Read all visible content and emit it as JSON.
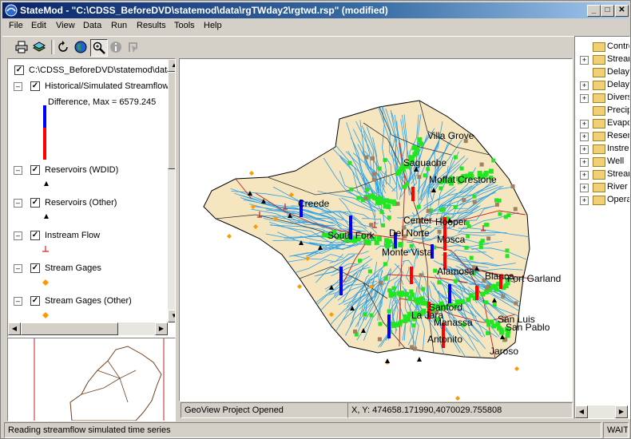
{
  "window": {
    "title": "StateMod - \"C:\\CDSS_BeforeDVD\\statemod\\data\\rgTWday2\\rgtwd.rsp\" (modified)",
    "minimize_glyph": "_",
    "maximize_glyph": "□",
    "close_glyph": "✕"
  },
  "menu": [
    "File",
    "Edit",
    "View",
    "Data",
    "Run",
    "Results",
    "Tools",
    "Help"
  ],
  "toolbar_icons": [
    "print-icon",
    "layers-icon",
    "refresh-icon",
    "globe-icon",
    "zoom-icon",
    "info-icon",
    "select-icon"
  ],
  "legend": {
    "project_path": "C:\\CDSS_BeforeDVD\\statemod\\data",
    "layers": [
      {
        "label": "Historical/Simulated Streamflow",
        "sub": "Difference, Max = 6579.245"
      },
      {
        "label": "Reservoirs (WDID)"
      },
      {
        "label": "Reservoirs (Other)"
      },
      {
        "label": "Instream Flow"
      },
      {
        "label": "Stream Gages"
      },
      {
        "label": "Stream Gages (Other)"
      }
    ],
    "expander": "–",
    "check": "✓"
  },
  "map": {
    "colors": {
      "basin": "#f5e6c0",
      "stream": "#2aa0e8",
      "road": "#c02020",
      "positive": "#0000ff",
      "negative": "#ff0000",
      "node": "#22e622",
      "diversion": "#a08060",
      "gage": "#ff9900"
    },
    "labels": [
      "Villa Grove",
      "Saguache",
      "Moffat",
      "Crestone",
      "Creede",
      "Center",
      "Hooper",
      "South Fork",
      "Del Norte",
      "Mosca",
      "Monte Vista",
      "Alamosa",
      "Blanca",
      "Fort Garland",
      "Sanford",
      "Manassa",
      "La Jara",
      "San Luis",
      "San Pablo",
      "Antonito",
      "Jaroso"
    ]
  },
  "tree": {
    "items": [
      "Control",
      "Streamflow",
      "Delay Tables (Monthly)",
      "Delay Tables (Daily)",
      "Diversion",
      "Precipitation",
      "Evaporation",
      "Reservoir",
      "Instream Flow",
      "Well",
      "Stream Estimate",
      "River Network",
      "Operational Rights"
    ]
  },
  "status": {
    "geoview": "GeoView Project Opened",
    "coords": "X, Y:  474658.171990,4070029.755808",
    "message": "Reading streamflow simulated time series",
    "state": "WAIT"
  }
}
